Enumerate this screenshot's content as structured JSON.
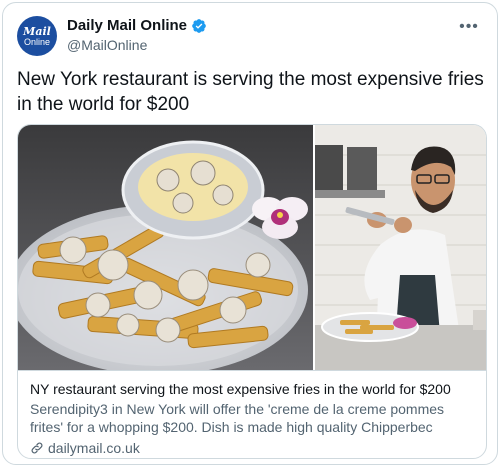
{
  "account": {
    "avatar_line1": "Mail",
    "avatar_line2": "Online",
    "display_name": "Daily Mail Online",
    "handle": "@MailOnline"
  },
  "more_label": "•••",
  "tweet": {
    "text": "New York restaurant is serving the most expensive fries in the world for $200"
  },
  "card": {
    "title": "NY restaurant serving the most expensive fries in the world for $200",
    "description": "Serendipity3 in New York will offer the 'creme de la creme pommes frites' for a whopping $200. Dish is made high quality Chipperbec potatoes, which are triple...",
    "domain": "dailymail.co.uk"
  },
  "colors": {
    "verified": "#1d9bf0",
    "avatar_bg": "#1c4ea0",
    "secondary_text": "#536471",
    "border": "#cfd9de"
  },
  "icons": [
    "verified-badge-icon",
    "more-options-icon",
    "link-icon"
  ]
}
